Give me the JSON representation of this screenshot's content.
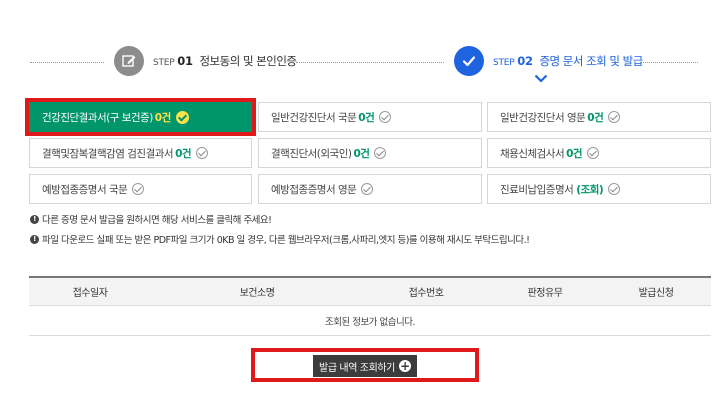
{
  "steps": [
    {
      "num_prefix": "STEP",
      "num": "01",
      "label": "정보동의 및 본인인증",
      "icon": "edit-icon"
    },
    {
      "num_prefix": "STEP",
      "num": "02",
      "label": "증명 문서 조회 및 발급",
      "icon": "check-icon"
    }
  ],
  "documents": [
    {
      "label": "건강진단결과서(구 보건증)",
      "count": "0건",
      "active": true
    },
    {
      "label": "일반건강진단서 국문",
      "count": "0건",
      "active": false
    },
    {
      "label": "일반건강진단서 영문",
      "count": "0건",
      "active": false
    },
    {
      "label": "결핵및잠복결핵감염 검진결과서",
      "count": "0건",
      "active": false
    },
    {
      "label": "결핵진단서(외국인)",
      "count": "0건",
      "active": false
    },
    {
      "label": "채용신체검사서",
      "count": "0건",
      "active": false
    },
    {
      "label": "예방접종증명서 국문",
      "count": "",
      "active": false
    },
    {
      "label": "예방접종증명서 영문",
      "count": "",
      "active": false
    },
    {
      "label": "진료비납입증명서",
      "count": "(조회)",
      "active": false
    }
  ],
  "notices": [
    "다른 증명 문서 발급을 원하시면 해당 서비스를 클릭해 주세요!",
    "파일 다운로드 실패 또는 받은 PDF파일 크기가 0KB 일 경우, 다른 웹브라우저(크롬,사파리,엣지 등)를 이용해 재시도 부탁드립니다.!"
  ],
  "table": {
    "headers": [
      "접수일자",
      "보건소명",
      "접수번호",
      "판정유무",
      "발급신청"
    ],
    "empty_message": "조회된 정보가 없습니다."
  },
  "button": {
    "label": "발급 내역 조회하기",
    "icon": "plus-circle-icon"
  },
  "colors": {
    "accent_green": "#00956b",
    "step_blue": "#1e64e0",
    "highlight_red": "#e01a1a",
    "count_yellow": "#ffe14a"
  }
}
